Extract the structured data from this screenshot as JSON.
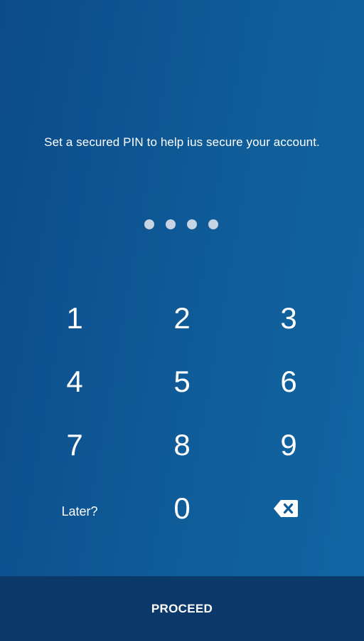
{
  "prompt_text": "Set a secured PIN to help ius secure your account.",
  "pin": {
    "length": 4,
    "entered": 4
  },
  "keypad": {
    "keys": [
      "1",
      "2",
      "3",
      "4",
      "5",
      "6",
      "7",
      "8",
      "9"
    ],
    "later_label": "Later?",
    "zero_label": "0",
    "backspace_icon": "backspace-icon"
  },
  "proceed_label": "PROCEED",
  "colors": {
    "background_start": "#0c4b8a",
    "background_end": "#1166a3",
    "proceed_bar": "#0b3a6a",
    "pin_dot": "#c6d4e3",
    "text": "#ffffff"
  }
}
